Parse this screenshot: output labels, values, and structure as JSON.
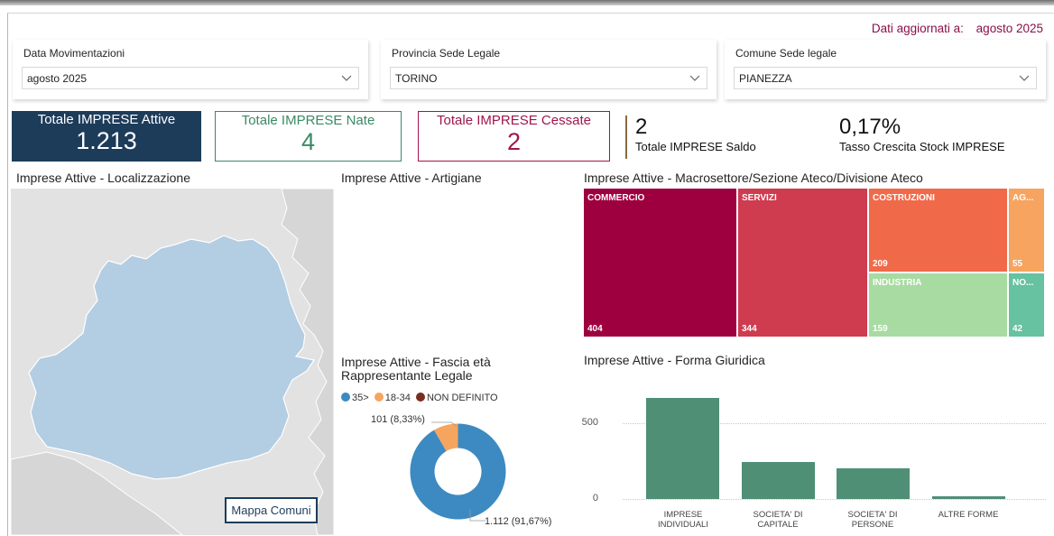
{
  "header": {
    "updated_label": "Dati aggiornati a:",
    "updated_value": "agosto 2025"
  },
  "slicers": [
    {
      "title": "Data Movimentazioni",
      "value": "agosto 2025"
    },
    {
      "title": "Provincia Sede Legale",
      "value": "TORINO"
    },
    {
      "title": "Comune Sede legale",
      "value": "PIANEZZA"
    }
  ],
  "kpi_cards": [
    {
      "label": "Totale IMPRESE Attive",
      "value": "1.213",
      "color": "#1d3c5a"
    },
    {
      "label": "Totale IMPRESE Nate",
      "value": "4",
      "color": "#3a8a64"
    },
    {
      "label": "Totale IMPRESE Cessate",
      "value": "2",
      "color": "#a0154e"
    }
  ],
  "kpi_plain": [
    {
      "value": "2",
      "label": "Totale IMPRESE Saldo"
    },
    {
      "value": "0,17%",
      "label": "Tasso Crescita Stock IMPRESE"
    }
  ],
  "visuals": {
    "map_title": "Imprese Attive - Localizzazione",
    "map_button": "Mappa Comuni",
    "artigiane_title": "Imprese Attive - Artigiane",
    "treemap_title": "Imprese Attive - Macrosettore/Sezione Ateco/Divisione Ateco",
    "donut_title": "Imprese Attive - Fascia età Rappresentante Legale",
    "forma_title": "Imprese Attive - Forma Giuridica"
  },
  "colors": {
    "accent_blue": "#1d3c5a",
    "region_fill": "#b3cde3",
    "bar_green": "#4e8f76"
  },
  "chart_data": [
    {
      "type": "treemap",
      "items": [
        {
          "name": "COMMERCIO",
          "value": 404,
          "label": "404",
          "color": "#9e003f"
        },
        {
          "name": "SERVIZI",
          "value": 344,
          "label": "344",
          "color": "#cf3b4f"
        },
        {
          "name": "COSTRUZIONI",
          "value": 209,
          "label": "209",
          "color": "#f06a4a"
        },
        {
          "name": "AG...",
          "value": 55,
          "label": "55",
          "color": "#f6a45f"
        },
        {
          "name": "INDUSTRIA",
          "value": 159,
          "label": "159",
          "color": "#a8dba2"
        },
        {
          "name": "NO...",
          "value": 42,
          "label": "42",
          "color": "#66c2a1"
        }
      ]
    },
    {
      "type": "pie",
      "legend": [
        {
          "name": "35>",
          "color": "#3c8ac1"
        },
        {
          "name": "18-34",
          "color": "#f6a55e"
        },
        {
          "name": "NON DEFINITO",
          "color": "#7a2e1e"
        }
      ],
      "slices": [
        {
          "name": "35>",
          "value": 1112,
          "label": "1.112 (91,67%)"
        },
        {
          "name": "18-34",
          "value": 101,
          "label": "101 (8,33%)"
        }
      ]
    },
    {
      "type": "bar",
      "categories": [
        "IMPRESE INDIVIDUALI",
        "SOCIETA' DI CAPITALE",
        "SOCIETA' DI PERSONE",
        "ALTRE FORME"
      ],
      "values": [
        708,
        262,
        213,
        20
      ],
      "yticks": [
        "500",
        "0"
      ],
      "ylim": [
        0,
        800
      ],
      "grid": true
    }
  ]
}
